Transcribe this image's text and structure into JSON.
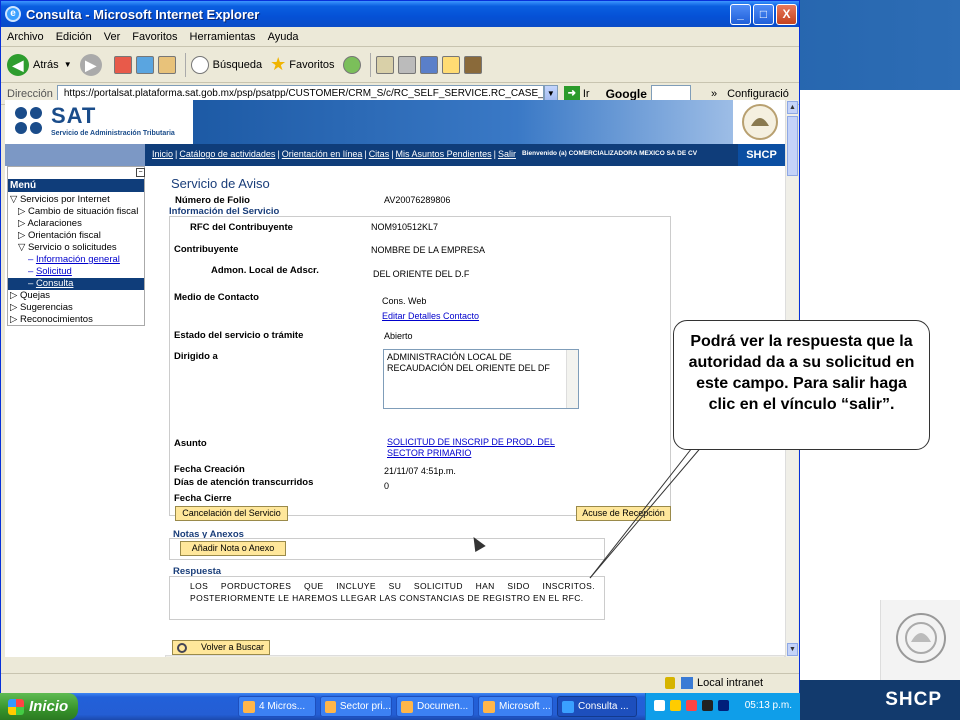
{
  "window": {
    "title": "Consulta - Microsoft Internet Explorer",
    "minimize": "_",
    "maximize": "□",
    "close": "X"
  },
  "menubar": [
    "Archivo",
    "Edición",
    "Ver",
    "Favoritos",
    "Herramientas",
    "Ayuda"
  ],
  "toolbar": {
    "back": "Atrás",
    "search": "Búsqueda",
    "favorites": "Favoritos"
  },
  "address": {
    "label": "Dirección",
    "url": "https://portalsat.plataforma.sat.gob.mx/psp/psatpp/CUSTOMER/CRM_S/c/RC_SELF_SERVICE.RC_CASE_SW_SS_SRCH.GBL",
    "go": "Ir",
    "google": "Google",
    "config": "Configuració"
  },
  "header": {
    "logo_main": "SAT",
    "logo_sub": "Servicio de Administración Tributaria",
    "shcp_tab": "SHCP"
  },
  "nav": {
    "links": [
      "Inicio",
      "Catálogo de actividades",
      "Orientación en línea",
      "Citas",
      "Mis Asuntos Pendientes",
      "Salir"
    ],
    "welcome": "Bienvenido (a) COMERCIALIZADORA MEXICO SA DE CV"
  },
  "menu": {
    "collapse": "−",
    "title": "Menú",
    "items": [
      {
        "label": "Servicios por Internet",
        "level": 1,
        "icon": "▽"
      },
      {
        "label": "Cambio de situación fiscal",
        "level": 2,
        "icon": "▷"
      },
      {
        "label": "Aclaraciones",
        "level": 2,
        "icon": "▷"
      },
      {
        "label": "Orientación fiscal",
        "level": 2,
        "icon": "▷"
      },
      {
        "label": "Servicio o solicitudes",
        "level": 2,
        "icon": "▽"
      },
      {
        "label": "Información general",
        "level": 3,
        "icon": "–"
      },
      {
        "label": "Solicitud",
        "level": 3,
        "icon": "–"
      },
      {
        "label": "Consulta",
        "level": 3,
        "icon": "–"
      },
      {
        "label": "Quejas",
        "level": 1,
        "icon": "▷"
      },
      {
        "label": "Sugerencias",
        "level": 1,
        "icon": "▷"
      },
      {
        "label": "Reconocimientos",
        "level": 1,
        "icon": "▷"
      }
    ]
  },
  "form": {
    "heading": "Servicio de Aviso",
    "folio_label": "Número de Folio",
    "folio_value": "AV20076289806",
    "info_section": "Información del Servicio",
    "rfc_label": "RFC del Contribuyente",
    "rfc_value": "NOM910512KL7",
    "contrib_label": "Contribuyente",
    "contrib_value": "NOMBRE DE LA EMPRESA",
    "admon_label": "Admon. Local de Adscr.",
    "admon_value": "DEL ORIENTE DEL D.F",
    "medio_label": "Medio de Contacto",
    "medio_value": "Cons. Web",
    "edit_contact": "Editar Detalles Contacto",
    "estado_label": "Estado del servicio o trámite",
    "estado_value": "Abierto",
    "dirigido_label": "Dirigido a",
    "dirigido_value": "ADMINISTRACIÓN LOCAL DE RECAUDACIÓN DEL ORIENTE DEL DF",
    "asunto_label": "Asunto",
    "asunto_value": "SOLICITUD DE INSCRIP DE PROD. DEL SECTOR PRIMARIO",
    "fecha_label": "Fecha Creación",
    "fecha_value": "21/11/07  4:51p.m.",
    "dias_label": "Días de atención transcurridos",
    "dias_value": "0",
    "cierre_label": "Fecha Cierre",
    "cancel_button": "Cancelación del Servicio",
    "acuse_button": "Acuse de Recepción",
    "notas_section": "Notas y Anexos",
    "add_note_button": "Añadir Nota o Anexo",
    "respuesta_section": "Respuesta",
    "respuesta_value": "LOS PORDUCTORES QUE INCLUYE SU SOLICITUD HAN SIDO INSCRITOS. POSTERIORMENTE LE HAREMOS LLEGAR LAS CONSTANCIAS DE REGISTRO EN EL RFC.",
    "back_button": "Volver a Buscar"
  },
  "status": {
    "zone": "Local intranet"
  },
  "taskbar": {
    "start": "Inicio",
    "tasks": [
      "4 Micros...",
      "Sector pri...",
      "Documen...",
      "Microsoft ...",
      "Consulta ..."
    ],
    "time": "05:13 p.m."
  },
  "callout": {
    "text": "Podrá ver la respuesta que la autoridad da a su solicitud en este campo. Para salir haga clic en el vínculo “salir”."
  },
  "slide": {
    "footer": "SHCP"
  },
  "colors": {
    "sat_blue": "#1a4c8a",
    "nav_blue": "#0f3d7a",
    "button_yellow": "#ffe79b",
    "link": "#0000cc"
  }
}
